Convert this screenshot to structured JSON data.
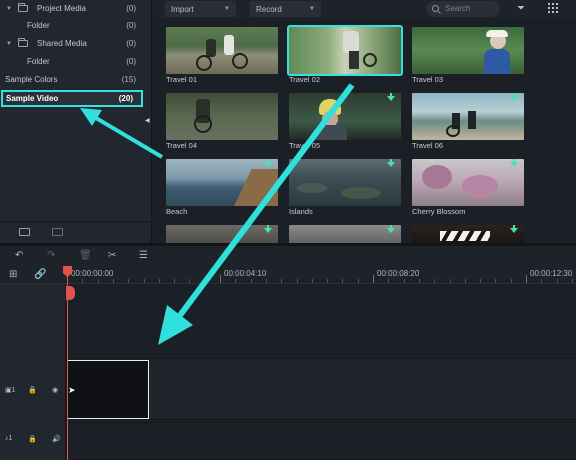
{
  "library": {
    "project_media": {
      "label": "Project Media",
      "count": "(0)"
    },
    "project_folder": {
      "label": "Folder",
      "count": "(0)"
    },
    "shared_media": {
      "label": "Shared Media",
      "count": "(0)"
    },
    "shared_folder": {
      "label": "Folder",
      "count": "(0)"
    },
    "sample_colors": {
      "label": "Sample Colors",
      "count": "(15)"
    },
    "sample_video": {
      "label": "Sample Video",
      "count": "(20)"
    }
  },
  "toolbar": {
    "import_label": "Import",
    "record_label": "Record",
    "search_placeholder": "Search"
  },
  "media": [
    {
      "caption": "Travel 01",
      "download": false
    },
    {
      "caption": "Travel 02",
      "download": false,
      "selected": true
    },
    {
      "caption": "Travel 03",
      "download": false
    },
    {
      "caption": "Travel 04",
      "download": false
    },
    {
      "caption": "Travel 05",
      "download": true
    },
    {
      "caption": "Travel 06",
      "download": true
    },
    {
      "caption": "Beach",
      "download": true
    },
    {
      "caption": "Islands",
      "download": true
    },
    {
      "caption": "Cherry Blossom",
      "download": true
    }
  ],
  "timeline": {
    "timecodes": [
      "00:00:00:00",
      "00:00:04:10",
      "00:00:08:20",
      "00:00:12:30"
    ]
  },
  "colors": {
    "accent": "#37e0dc",
    "playhead": "#e0534a",
    "download": "#4be0b0"
  }
}
